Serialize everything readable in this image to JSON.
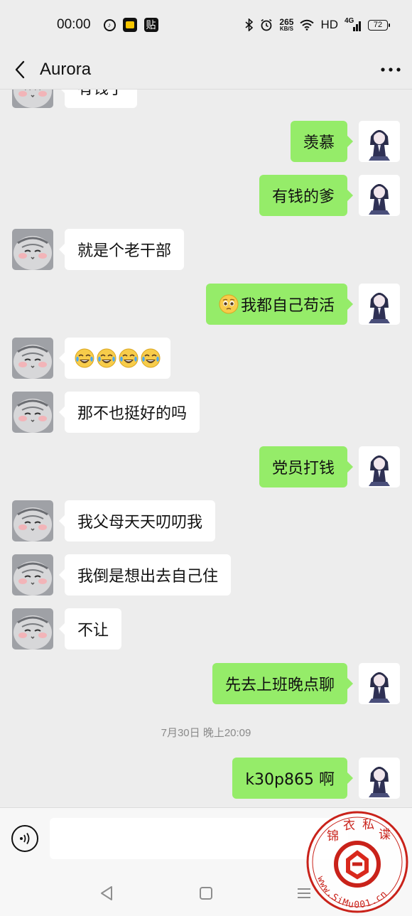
{
  "status_bar": {
    "time": "00:00",
    "app_icons": [
      "netease-music-icon",
      "yellow-app-icon",
      "tieba-icon"
    ],
    "tieba_glyph": "贴",
    "net_speed_value": "265",
    "net_speed_unit": "KB/S",
    "hd_label": "HD",
    "signal_label": "4G",
    "battery_level": "72"
  },
  "header": {
    "title": "Aurora"
  },
  "messages": [
    {
      "side": "left",
      "text": "有钱了",
      "partial": true
    },
    {
      "side": "right",
      "text": "羡慕"
    },
    {
      "side": "right",
      "text": "有钱的爹"
    },
    {
      "side": "left",
      "text": "就是个老干部"
    },
    {
      "side": "right",
      "emoji": "pleading-face",
      "text": "我都自己苟活"
    },
    {
      "side": "left",
      "emoji_row": [
        "tears-of-joy",
        "tears-of-joy",
        "tears-of-joy",
        "tears-of-joy"
      ]
    },
    {
      "side": "left",
      "text": "那不也挺好的吗"
    },
    {
      "side": "right",
      "text": "党员打钱"
    },
    {
      "side": "left",
      "text": "我父母天天叨叨我"
    },
    {
      "side": "left",
      "text": "我倒是想出去自己住"
    },
    {
      "side": "left",
      "text": "不让"
    },
    {
      "side": "right",
      "text": "先去上班晚点聊"
    },
    {
      "timestamp": "7月30日 晚上20:09"
    },
    {
      "side": "right",
      "text": "k30p865 啊"
    }
  ],
  "input_bar": {
    "value": "",
    "placeholder": ""
  },
  "watermark": {
    "top_chars": [
      "锦",
      "衣",
      "私",
      "谍"
    ],
    "url": "www.SiMu001.cn"
  },
  "colors": {
    "background": "#ededed",
    "bubble_self": "#95ec69",
    "bubble_other": "#ffffff",
    "watermark_red": "#d9281c"
  }
}
